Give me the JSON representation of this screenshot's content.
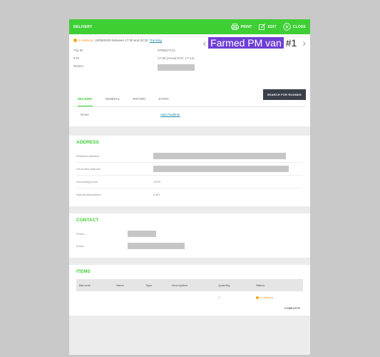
{
  "topbar": {
    "title": "DELIVERY",
    "print_label": "PRINT",
    "edit_label": "EDIT",
    "close_label": "CLOSE"
  },
  "header": {
    "status": "In delivery",
    "status_detail": " - 22/09/2020 between 17:30 and 22:30",
    "tracking_link": "Tracking",
    "van_label": "Farmed PM van",
    "van_number": "#1",
    "trip_id_label": "Trip ID",
    "trip_id_value": "9786547114",
    "eta_label": "ETA",
    "eta_value": "17:30 (Actual ETA: 17:14)",
    "district_label": "District",
    "search_button": "SEARCH FOR ROUNDS"
  },
  "tabs": [
    {
      "label": "DELIVERY"
    },
    {
      "label": "GENERAL"
    },
    {
      "label": "HISTORY"
    },
    {
      "label": "EXTRA"
    }
  ],
  "driver": {
    "label": "Driver",
    "value": "Alan Faulkner"
  },
  "address": {
    "title": "ADDRESS",
    "rows": [
      {
        "label": "Resolved address"
      },
      {
        "label": "Geocoded address"
      },
      {
        "label": "Geocoding score",
        "value": "100%"
      },
      {
        "label": "Special instructions",
        "value": "A BG"
      }
    ]
  },
  "contact": {
    "title": "CONTACT",
    "rows": [
      {
        "label": "Phone"
      },
      {
        "label": "Email"
      }
    ]
  },
  "items": {
    "title": "ITEMS",
    "columns": [
      "Barcode",
      "Name",
      "Type",
      "Description",
      "Quantity",
      "Status"
    ],
    "rows": [
      {
        "quantity": "1",
        "status": "In delivery"
      }
    ],
    "complete_label": "COMPLETE"
  },
  "colors": {
    "accent": "#3ecf35",
    "status": "#f2a71b",
    "van_badge": "#6f3fd6"
  }
}
